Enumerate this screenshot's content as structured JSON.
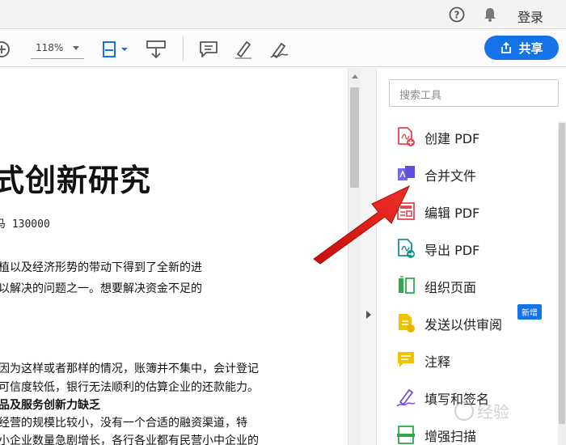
{
  "topbar": {
    "help_icon": "help-circle-icon",
    "bell_icon": "bell-icon",
    "login_label": "登录"
  },
  "toolbar": {
    "zoom_value": "118%",
    "share_label": "共享"
  },
  "document": {
    "title": "式创新研究",
    "meta": "⻢   130000",
    "lines": [
      "植以及经济形势的带动下得到了全新的进",
      "以解决的问题之一。想要解决资金不足的",
      "因为这样或者那样的情况，账簿并不集中，会计登记",
      "可信度较低，银行无法顺利的估算企业的还款能力。",
      "品及服务创新力缺乏",
      "经营的规模比较小，没有一个合适的融资渠道，特",
      "小企业数量急剧增长，各行各业都有民营小中企业的"
    ]
  },
  "panel": {
    "search_placeholder": "搜索工具",
    "tools": [
      {
        "label": "创建 PDF",
        "icon": "create-pdf-icon",
        "color": "#e34850"
      },
      {
        "label": "合并文件",
        "icon": "combine-files-icon",
        "color": "#5b4fe0"
      },
      {
        "label": "编辑 PDF",
        "icon": "edit-pdf-icon",
        "color": "#e34850"
      },
      {
        "label": "导出 PDF",
        "icon": "export-pdf-icon",
        "color": "#15908f"
      },
      {
        "label": "组织页面",
        "icon": "organize-pages-icon",
        "color": "#2fa84f"
      },
      {
        "label": "发送以供审阅",
        "icon": "send-review-icon",
        "color": "#e8b400"
      },
      {
        "label": "注释",
        "icon": "comment-icon",
        "color": "#e8b400"
      },
      {
        "label": "填写和签名",
        "icon": "fill-sign-icon",
        "color": "#7b4dd6"
      },
      {
        "label": "增强扫描",
        "icon": "enhance-scan-icon",
        "color": "#2fa84f"
      }
    ],
    "new_badge": "新增"
  },
  "colors": {
    "accent": "#1473e6",
    "arrow": "#e8231d"
  }
}
